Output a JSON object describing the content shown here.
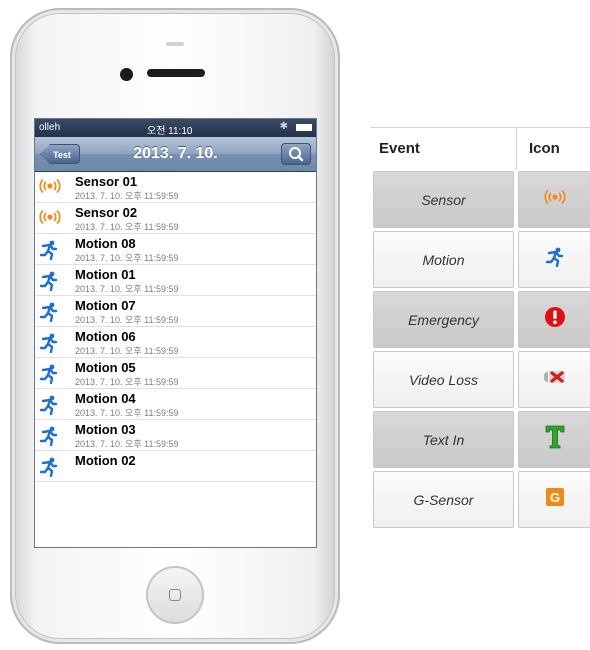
{
  "phone": {
    "status": {
      "carrier": "olleh",
      "time": "오전 11:10"
    },
    "nav": {
      "back_label": "Test",
      "title": "2013. 7. 10."
    },
    "list": [
      {
        "title": "Sensor 01",
        "time": "2013. 7. 10. 오후 11:59:59",
        "icon": "sensor-icon"
      },
      {
        "title": "Sensor 02",
        "time": "2013. 7. 10. 오후 11:59:59",
        "icon": "sensor-icon"
      },
      {
        "title": "Motion 08",
        "time": "2013. 7. 10. 오후 11:59:59",
        "icon": "motion-icon"
      },
      {
        "title": "Motion 01",
        "time": "2013. 7. 10. 오후 11:59:59",
        "icon": "motion-icon"
      },
      {
        "title": "Motion 07",
        "time": "2013. 7. 10. 오후 11:59:59",
        "icon": "motion-icon"
      },
      {
        "title": "Motion 06",
        "time": "2013. 7. 10. 오후 11:59:59",
        "icon": "motion-icon"
      },
      {
        "title": "Motion 05",
        "time": "2013. 7. 10. 오후 11:59:59",
        "icon": "motion-icon"
      },
      {
        "title": "Motion 04",
        "time": "2013. 7. 10. 오후 11:59:59",
        "icon": "motion-icon"
      },
      {
        "title": "Motion 03",
        "time": "2013. 7. 10. 오후 11:59:59",
        "icon": "motion-icon"
      },
      {
        "title": "Motion 02",
        "time": "",
        "icon": "motion-icon"
      }
    ]
  },
  "legend": {
    "header": {
      "event": "Event",
      "icon": "Icon"
    },
    "rows": [
      {
        "event": "Sensor",
        "icon": "sensor-icon"
      },
      {
        "event": "Motion",
        "icon": "motion-icon"
      },
      {
        "event": "Emergency",
        "icon": "emergency-icon"
      },
      {
        "event": "Video Loss",
        "icon": "video-loss-icon"
      },
      {
        "event": "Text In",
        "icon": "text-in-icon"
      },
      {
        "event": "G-Sensor",
        "icon": "g-sensor-icon"
      }
    ]
  },
  "colors": {
    "sensor": "#f08a1c",
    "motion": "#1f6fd0",
    "emergency": "#e01010",
    "video_loss": "#d02020",
    "text_in": "#2fa52a",
    "g_sensor": "#f28a12",
    "navbar": "#7890b0"
  }
}
